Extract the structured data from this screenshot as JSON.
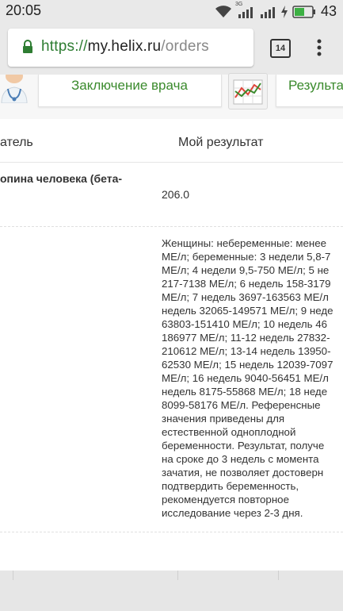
{
  "status_bar": {
    "time": "20:05",
    "network_type": "3G",
    "battery_percent": "43"
  },
  "browser": {
    "url_scheme": "https://",
    "url_host": "my.helix.ru",
    "url_path": "/orders",
    "tab_count": "14"
  },
  "cards": {
    "doctor_label": "Заключение врача",
    "results_label": "Результа"
  },
  "table": {
    "col_indicator": "атель",
    "col_result": "Мой результат",
    "rows": [
      {
        "name": "опина человека (бета-",
        "value": "206.0"
      },
      {
        "reference_lines": [
          "Женщины: небеременные: менее",
          "МЕ/л; беременные: 3 недели 5,8-7",
          "МЕ/л; 4 недели 9,5-750 МЕ/л; 5 не",
          "217-7138 МЕ/л; 6 недель 158-3179",
          "МЕ/л; 7 недель 3697-163563 МЕ/л",
          "недель 32065-149571 МЕ/л; 9 неде",
          "63803-151410 МЕ/л; 10 недель 46",
          "186977 МЕ/л; 11-12 недель 27832-",
          "210612 МЕ/л; 13-14 недель 13950-",
          "62530 МЕ/л; 15 недель 12039-7097",
          "МЕ/л; 16 недель 9040-56451 МЕ/л",
          "недель 8175-55868 МЕ/л; 18 неде",
          "8099-58176 МЕ/л. Референсные",
          "значения приведены для",
          "естественной одноплодной",
          "беременности. Результат, получе",
          "на сроке до 3 недель с момента",
          "зачатия, не позволяет достоверн",
          "подтвердить беременность,",
          "рекомендуется повторное",
          "исследование через 2-3 дня."
        ]
      }
    ]
  },
  "colors": {
    "accent_green": "#3a8a2c",
    "url_scheme_green": "#2e7d32"
  },
  "icons": {
    "doctor": "doctor-icon",
    "results": "line-chart-icon",
    "lock": "lock-icon",
    "menu": "more-vert-icon"
  }
}
